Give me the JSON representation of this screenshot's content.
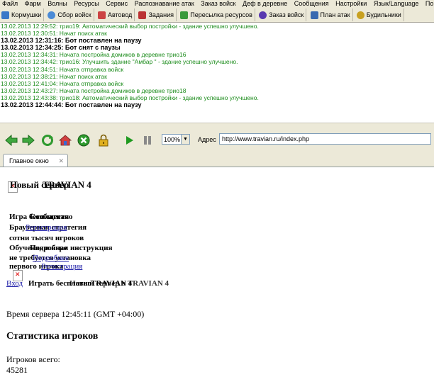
{
  "menu": [
    "Файл",
    "Фарм",
    "Волны",
    "Ресурсы",
    "Сервис",
    "Распознавание атак",
    "Заказ войск",
    "Деф в деревне",
    "Сообщения",
    "Настройки",
    "Язык/Language",
    "Помощь"
  ],
  "tool_tabs": [
    {
      "label": "Кормушки",
      "color": "#3a78c8"
    },
    {
      "label": "Сбор войск",
      "color": "#4b8bd6"
    },
    {
      "label": "Автовод",
      "color": "#c44"
    },
    {
      "label": "Задания",
      "color": "#b33"
    },
    {
      "label": "Пересылка ресурсов",
      "color": "#3a9a3a"
    },
    {
      "label": "Заказ войск",
      "color": "#5a3ab0"
    },
    {
      "label": "План атак",
      "color": "#3a6ab0"
    },
    {
      "label": "Будильники",
      "color": "#c8a020"
    }
  ],
  "log": [
    {
      "text": "13.02.2013 12:29:52: трио19: Автоматический выбор постройки - здание успешно улучшено.",
      "style": "green"
    },
    {
      "text": "13.02.2013 12:30:51: Начат поиск атак",
      "style": "green"
    },
    {
      "text": "13.02.2013 12:31:16: Бот поставлен на паузу",
      "style": "bold"
    },
    {
      "text": "13.02.2013 12:34:25: Бот снят с паузы",
      "style": "bold"
    },
    {
      "text": "13.02.2013 12:34:31: Начата постройка домиков в деревне трио16",
      "style": "green"
    },
    {
      "text": "13.02.2013 12:34:42: трио16: Улучшить здание \"Амбар \" - здание успешно улучшено.",
      "style": "green"
    },
    {
      "text": "13.02.2013 12:34:51: Начата отправка войск",
      "style": "green"
    },
    {
      "text": "13.02.2013 12:38:21: Начат поиск атак",
      "style": "green"
    },
    {
      "text": "13.02.2013 12:41:04: Начата отправка войск",
      "style": "green"
    },
    {
      "text": "13.02.2013 12:43:27: Начата постройка домиков в деревне трио18",
      "style": "green"
    },
    {
      "text": "13.02.2013 12:43:38: трио18: Автоматический выбор постройки - здание успешно улучшено.",
      "style": "green"
    },
    {
      "text": "13.02.2013 12:44:44: Бот поставлен на паузу",
      "style": "bold"
    }
  ],
  "browser": {
    "zoom": "100%",
    "address_label": "Адрес",
    "url": "http://www.travian.ru/index.php",
    "tab_label": "Главное окно"
  },
  "page": {
    "heading_overlap": [
      "Новый сервер",
      "TRAVIAN 4"
    ],
    "block_text": [
      "Игра бесплатная",
      "Сообщество",
      "Браузерная стратегия",
      "сотни тысяч игроков",
      "Обучение в игре",
      "Подробная инструкция",
      "не требуется установка",
      "первого игрока"
    ],
    "links": [
      "Регистрация",
      "Подробнее",
      "Вход",
      "Регистрация"
    ],
    "bottom_overlap": [
      "Играть бесплатно",
      "TRAVIAN 4",
      "Новый сервер в TRAVIAN 4"
    ],
    "server_time": "Время сервера 12:45:11 (GMT +04:00)",
    "stats_heading": "Статистика игроков",
    "players_label": "Игроков всего:",
    "players_value": "45281"
  }
}
